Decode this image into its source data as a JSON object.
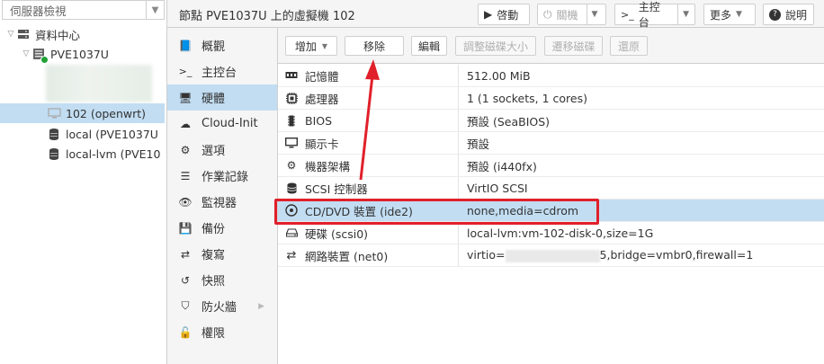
{
  "window": {
    "title": "節點 PVE1037U 上的虛擬機 102"
  },
  "left_panel": {
    "view_select": "伺服器檢視",
    "tree": [
      {
        "label": "資料中心",
        "icon": "server-rack-icon"
      },
      {
        "label": "PVE1037U",
        "icon": "node-icon"
      },
      {
        "label": "102 (openwrt)",
        "icon": "vm-monitor-icon",
        "selected": true
      },
      {
        "label": "local (PVE1037U",
        "icon": "storage-icon"
      },
      {
        "label": "local-lvm (PVE10",
        "icon": "storage-icon"
      }
    ]
  },
  "header_buttons": {
    "start": "啓動",
    "shutdown": "關機",
    "console": "主控台",
    "more": "更多",
    "help": "說明"
  },
  "nav": {
    "items": [
      {
        "label": "概觀",
        "icon": "book-icon"
      },
      {
        "label": "主控台",
        "icon": "terminal-icon"
      },
      {
        "label": "硬體",
        "icon": "desktop-icon",
        "active": true
      },
      {
        "label": "Cloud-Init",
        "icon": "cloud-icon"
      },
      {
        "label": "選項",
        "icon": "gear-icon"
      },
      {
        "label": "作業記錄",
        "icon": "list-icon"
      },
      {
        "label": "監視器",
        "icon": "eye-icon"
      },
      {
        "label": "備份",
        "icon": "floppy-icon"
      },
      {
        "label": "複寫",
        "icon": "retweet-icon"
      },
      {
        "label": "快照",
        "icon": "history-icon"
      },
      {
        "label": "防火牆",
        "icon": "shield-icon"
      },
      {
        "label": "權限",
        "icon": "unlock-icon"
      }
    ]
  },
  "toolbar": {
    "add": "增加",
    "remove": "移除",
    "edit": "編輯",
    "resize": "調整磁碟大小",
    "move": "遷移磁碟",
    "revert": "還原"
  },
  "hardware": [
    {
      "key": "記憶體",
      "value": "512.00 MiB",
      "icon": "memory-icon"
    },
    {
      "key": "處理器",
      "value": "1 (1 sockets, 1 cores)",
      "icon": "cpu-icon"
    },
    {
      "key": "BIOS",
      "value": "預設 (SeaBIOS)",
      "icon": "microchip-icon"
    },
    {
      "key": "顯示卡",
      "value": "預設",
      "icon": "display-icon"
    },
    {
      "key": "機器架構",
      "value": "預設 (i440fx)",
      "icon": "cogs-icon"
    },
    {
      "key": "SCSI 控制器",
      "value": "VirtIO SCSI",
      "icon": "database-icon"
    },
    {
      "key": "CD/DVD 裝置 (ide2)",
      "value": "none,media=cdrom",
      "icon": "cdrom-icon",
      "selected": true
    },
    {
      "key": "硬碟 (scsi0)",
      "value": "local-lvm:vm-102-disk-0,size=1G",
      "icon": "hdd-icon"
    },
    {
      "key": "網路裝置 (net0)",
      "value": "virtio=",
      "value_tail": "5,bridge=vmbr0,firewall=1",
      "icon": "exchange-icon"
    }
  ],
  "colors": {
    "selection": "#c2ddf2",
    "highlight": "#e0202a",
    "node_status": "#21a135"
  }
}
